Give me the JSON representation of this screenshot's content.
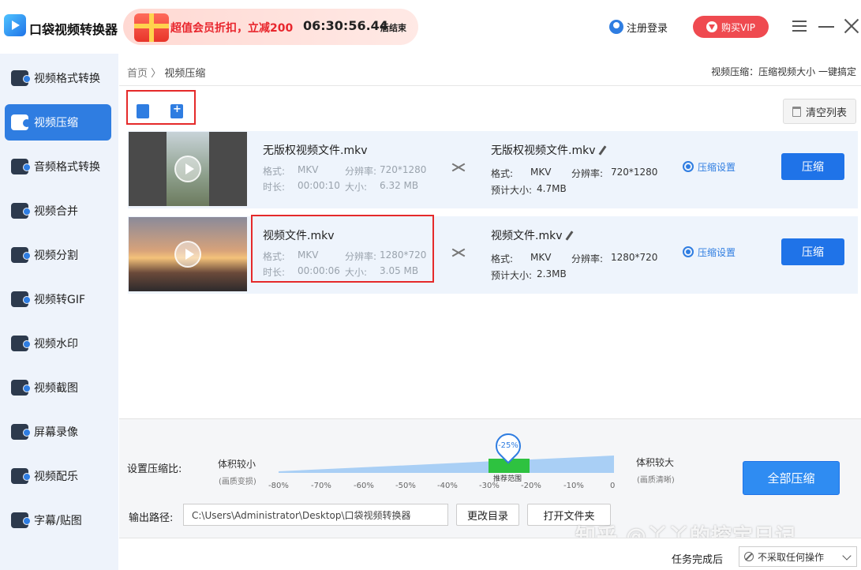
{
  "app": {
    "title": "口袋视频转换器"
  },
  "promo": {
    "text": "超值会员折扣，立减200",
    "countdown": "06:30:56.44",
    "suffix": "后结束"
  },
  "header": {
    "login": "注册登录",
    "vip": "购买VIP"
  },
  "sidebar": {
    "items": [
      {
        "label": "视频格式转换",
        "icon": "video-convert-icon"
      },
      {
        "label": "视频压缩",
        "icon": "video-compress-icon",
        "active": true
      },
      {
        "label": "音频格式转换",
        "icon": "audio-convert-icon"
      },
      {
        "label": "视频合并",
        "icon": "video-merge-icon"
      },
      {
        "label": "视频分割",
        "icon": "video-split-icon"
      },
      {
        "label": "视频转GIF",
        "icon": "gif-icon"
      },
      {
        "label": "视频水印",
        "icon": "watermark-icon"
      },
      {
        "label": "视频截图",
        "icon": "screenshot-icon"
      },
      {
        "label": "屏幕录像",
        "icon": "screen-record-icon"
      },
      {
        "label": "视频配乐",
        "icon": "music-icon"
      },
      {
        "label": "字幕/贴图",
        "icon": "subtitle-icon"
      }
    ]
  },
  "breadcrumb": {
    "home": "首页",
    "sep": "〉",
    "current": "视频压缩"
  },
  "top_tip": "视频压缩：压缩视频大小 一键搞定",
  "toolbar": {
    "clear": "清空列表"
  },
  "labels": {
    "format": "格式:",
    "duration": "时长:",
    "resolution": "分辨率:",
    "size": "大小:",
    "out_format": "格式:",
    "out_resolution": "分辨率:",
    "estimate": "预计大小:",
    "settings": "压缩设置",
    "compress": "压缩"
  },
  "files": [
    {
      "name": "无版权视频文件.mkv",
      "format": "MKV",
      "resolution": "720*1280",
      "duration": "00:00:10",
      "size": "6.32 MB",
      "out_name": "无版权视频文件.mkv",
      "out_format": "MKV",
      "out_resolution": "720*1280",
      "estimate": "4.7MB"
    },
    {
      "name": "视频文件.mkv",
      "format": "MKV",
      "resolution": "1280*720",
      "duration": "00:00:06",
      "size": "3.05 MB",
      "out_name": "视频文件.mkv",
      "out_format": "MKV",
      "out_resolution": "1280*720",
      "estimate": "2.3MB"
    }
  ],
  "compression": {
    "label": "设置压缩比:",
    "left_title": "体积较小",
    "left_sub": "(画质变损)",
    "right_title": "体积较大",
    "right_sub": "(画质清晰)",
    "value": "-25%",
    "value_fraction": 0.75,
    "recommended": "推荐范围",
    "ticks": [
      "-80%",
      "-70%",
      "-60%",
      "-50%",
      "-40%",
      "-30%",
      "-20%",
      "-10%",
      "0"
    ],
    "compress_all": "全部压缩"
  },
  "output": {
    "label": "输出路径:",
    "path": "C:\\Users\\Administrator\\Desktop\\口袋视频转换器",
    "change_dir": "更改目录",
    "open_folder": "打开文件夹"
  },
  "status": {
    "after_label": "任务完成后",
    "after_value": "不采取任何操作"
  },
  "watermark": "知乎 @丫丫的挖宝日记",
  "colors": {
    "accent": "#2f7de1",
    "vip": "#ef4a50",
    "highlight": "#e52a2a",
    "recommend": "#2ec240"
  }
}
